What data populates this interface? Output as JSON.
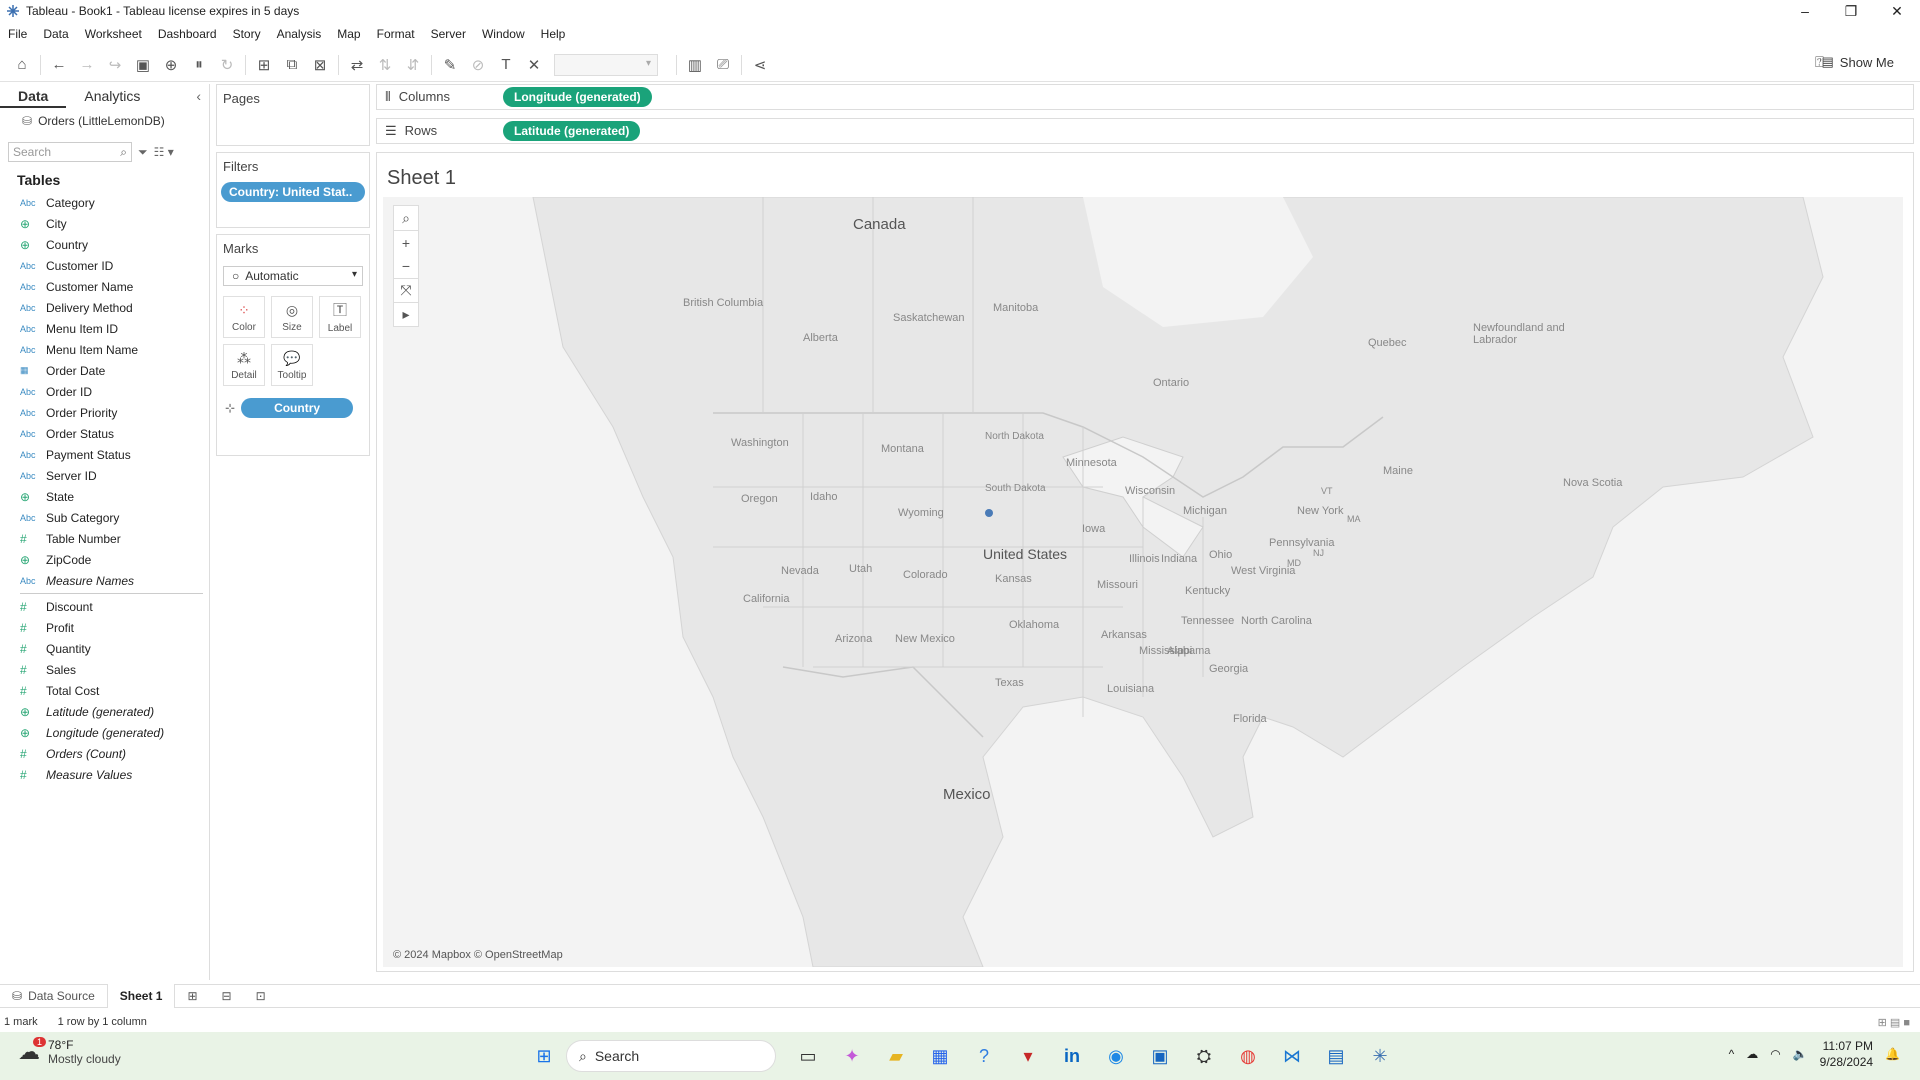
{
  "window": {
    "title": "Tableau - Book1 - Tableau license expires in 5 days"
  },
  "menu": [
    "File",
    "Data",
    "Worksheet",
    "Dashboard",
    "Story",
    "Analysis",
    "Map",
    "Format",
    "Server",
    "Window",
    "Help"
  ],
  "toolbar": {
    "show_me": "Show Me"
  },
  "datapane": {
    "tabs": [
      "Data",
      "Analytics"
    ],
    "datasource": "Orders (LittleLemonDB)",
    "search_placeholder": "Search",
    "tables_heading": "Tables",
    "dimensions": [
      {
        "icon": "Abc",
        "name": "Category"
      },
      {
        "icon": "globe",
        "name": "City"
      },
      {
        "icon": "globe",
        "name": "Country"
      },
      {
        "icon": "Abc",
        "name": "Customer ID"
      },
      {
        "icon": "Abc",
        "name": "Customer Name"
      },
      {
        "icon": "Abc",
        "name": "Delivery Method"
      },
      {
        "icon": "Abc",
        "name": "Menu Item ID"
      },
      {
        "icon": "Abc",
        "name": "Menu Item Name"
      },
      {
        "icon": "date",
        "name": "Order Date"
      },
      {
        "icon": "Abc",
        "name": "Order ID"
      },
      {
        "icon": "Abc",
        "name": "Order Priority"
      },
      {
        "icon": "Abc",
        "name": "Order Status"
      },
      {
        "icon": "Abc",
        "name": "Payment Status"
      },
      {
        "icon": "Abc",
        "name": "Server ID"
      },
      {
        "icon": "globe",
        "name": "State"
      },
      {
        "icon": "Abc",
        "name": "Sub Category"
      },
      {
        "icon": "#",
        "name": "Table Number"
      },
      {
        "icon": "globe",
        "name": "ZipCode"
      },
      {
        "icon": "Abc",
        "name": "Measure Names",
        "italic": true
      }
    ],
    "measures": [
      {
        "icon": "#",
        "name": "Discount"
      },
      {
        "icon": "#",
        "name": "Profit"
      },
      {
        "icon": "#",
        "name": "Quantity"
      },
      {
        "icon": "#",
        "name": "Sales"
      },
      {
        "icon": "#",
        "name": "Total Cost"
      },
      {
        "icon": "globe",
        "name": "Latitude (generated)",
        "italic": true
      },
      {
        "icon": "globe",
        "name": "Longitude (generated)",
        "italic": true
      },
      {
        "icon": "#",
        "name": "Orders (Count)",
        "italic": true
      },
      {
        "icon": "#",
        "name": "Measure Values",
        "italic": true
      }
    ]
  },
  "cards": {
    "pages": "Pages",
    "filters": "Filters",
    "filter_pill": "Country: United Stat..",
    "marks": "Marks",
    "mark_type": "Automatic",
    "mark_buttons": [
      "Color",
      "Size",
      "Label",
      "Detail",
      "Tooltip"
    ],
    "detail_pill": "Country"
  },
  "shelves": {
    "columns_label": "Columns",
    "columns_pill": "Longitude (generated)",
    "rows_label": "Rows",
    "rows_pill": "Latitude (generated)"
  },
  "sheet": {
    "title": "Sheet 1",
    "attribution": "© 2024 Mapbox © OpenStreetMap"
  },
  "map_labels": {
    "countries": [
      "Canada",
      "United States",
      "Mexico"
    ],
    "regions": [
      "British Columbia",
      "Alberta",
      "Saskatchewan",
      "Manitoba",
      "Ontario",
      "Quebec",
      "Newfoundland and Labrador",
      "Nova Scotia",
      "Washington",
      "Oregon",
      "California",
      "Nevada",
      "Idaho",
      "Montana",
      "Wyoming",
      "Utah",
      "Colorado",
      "Arizona",
      "New Mexico",
      "North Dakota",
      "South Dakota",
      "Kansas",
      "Oklahoma",
      "Texas",
      "Minnesota",
      "Iowa",
      "Missouri",
      "Arkansas",
      "Louisiana",
      "Wisconsin",
      "Illinois",
      "Indiana",
      "Michigan",
      "Ohio",
      "Kentucky",
      "Tennessee",
      "Mississippi",
      "Alabama",
      "Georgia",
      "Florida",
      "North Carolina",
      "West Virginia",
      "Pennsylvania",
      "New York",
      "Maine",
      "VT",
      "MA",
      "NJ",
      "MD"
    ]
  },
  "bottom": {
    "data_source_tab": "Data Source",
    "sheet_tab": "Sheet 1",
    "status_marks": "1 mark",
    "status_dims": "1 row by 1 column"
  },
  "taskbar": {
    "weather_temp": "78°F",
    "weather_desc": "Mostly cloudy",
    "weather_badge": "1",
    "search": "Search",
    "time": "11:07 PM",
    "date": "9/28/2024"
  }
}
